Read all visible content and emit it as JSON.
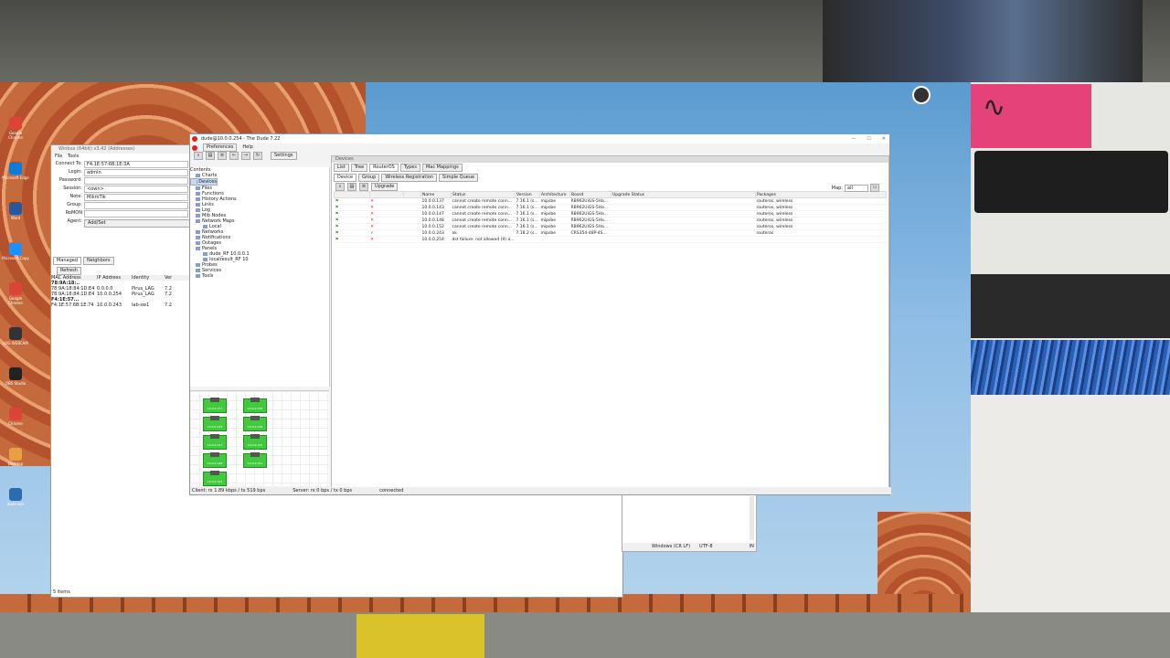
{
  "desktop": {
    "icons": [
      {
        "label": "Google Chrome",
        "color": "#db4437"
      },
      {
        "label": "Microsoft Edge",
        "color": "#0f7bd8"
      },
      {
        "label": "Word",
        "color": "#2b579a"
      },
      {
        "label": "Microsoft Copy",
        "color": "#1e90ff"
      },
      {
        "label": "Google Chrome",
        "color": "#db4437"
      },
      {
        "label": "LOG WEBCAM",
        "color": "#333333"
      },
      {
        "label": "OBS Studio",
        "color": "#222222"
      },
      {
        "label": "Chrome",
        "color": "#db4437"
      },
      {
        "label": "Desktop",
        "color": "#e8a040"
      },
      {
        "label": "dude-win",
        "color": "#2b6cb0"
      }
    ]
  },
  "winbox": {
    "title": "Winbox (64bit) v3.42 (Addresses)",
    "menu": [
      "File",
      "Tools"
    ],
    "fields": [
      {
        "label": "Connect To:",
        "value": "F4:1E:57:6B:1E:3A"
      },
      {
        "label": "Login:",
        "value": "admin"
      },
      {
        "label": "Password:",
        "value": ""
      },
      {
        "label": "Session:",
        "value": "<own>"
      },
      {
        "label": "Note:",
        "value": "MikroTik"
      },
      {
        "label": "Group:",
        "value": ""
      },
      {
        "label": "RoMON Agent:",
        "value": ""
      }
    ],
    "add_button": "Add/Set",
    "tabs": [
      "Managed",
      "Neighbors"
    ],
    "refresh": "Refresh",
    "columns": [
      "MAC Address",
      "IP Address",
      "Identity",
      "Vers"
    ],
    "rows": [
      [
        "78:9A:18:..",
        "",
        "",
        ""
      ],
      [
        "78:9A:18:84:1D:E4",
        "0.0.0.0",
        "Pirus_LAG",
        "7.22"
      ],
      [
        "78:9A:18:84:1D:E4",
        "10.0.0.254",
        "Pirus_LAG",
        "7.22"
      ],
      [
        "F4:1E:57...",
        "",
        "",
        ""
      ],
      [
        "F4:1E:57:6B:1E:74",
        "10.0.0.243",
        "lab-sw1",
        "7.22"
      ]
    ],
    "status": "5 items"
  },
  "bgwin": {
    "status": [
      "Windows (CR LF)",
      "UTF-8",
      "IN"
    ]
  },
  "dude": {
    "title": "dude@10.0.0.254 - The Dude 7.22",
    "menu": [
      "Preferences",
      "Help"
    ],
    "settings": "Settings",
    "tree_header": "Contents",
    "tree": [
      "Charts",
      "Devices",
      "Files",
      "Functions",
      "History Actions",
      "Links",
      "Log",
      "Mib Nodes",
      "Network Maps",
      "Local",
      "Networks",
      "Notifications",
      "Outages",
      "Panels",
      "dude_RF 10.0.0.1",
      "localresult_RF 10",
      "Probes",
      "Services",
      "Tools"
    ],
    "selected": "Devices",
    "panel_head": "Devices",
    "tabs": [
      "List",
      "Tree",
      "RouterOS",
      "Types",
      "Mac Mappings"
    ],
    "active_tab": "RouterOS",
    "subtabs": [
      "Device",
      "Group",
      "Wireless Registration",
      "Simple Queue"
    ],
    "upgrade": "Upgrade",
    "map_label": "Map:",
    "map_value": "all",
    "columns": [
      "Name",
      "Status",
      "Version",
      "Architecture",
      "Board",
      "Upgrade Status",
      "Packages"
    ],
    "rows": [
      {
        "name": "10.0.0.137",
        "status": "cannot create remote conn...",
        "version": "7.16.1 (s...",
        "arch": "mipsbe",
        "board": "RB962UiGS-5Ha...",
        "upgrade": "",
        "packages": "routeros, wireless"
      },
      {
        "name": "10.0.0.143",
        "status": "cannot create remote conn...",
        "version": "7.16.1 (s...",
        "arch": "mipsbe",
        "board": "RB962UiGS-5Ha...",
        "upgrade": "",
        "packages": "routeros, wireless"
      },
      {
        "name": "10.0.0.147",
        "status": "cannot create remote conn...",
        "version": "7.16.1 (s...",
        "arch": "mipsbe",
        "board": "RB962UiGS-5Ha...",
        "upgrade": "",
        "packages": "routeros, wireless"
      },
      {
        "name": "10.0.0.148",
        "status": "cannot create remote conn...",
        "version": "7.16.1 (s...",
        "arch": "mipsbe",
        "board": "RB962UiGS-5Ha...",
        "upgrade": "",
        "packages": "routeros, wireless"
      },
      {
        "name": "10.0.0.152",
        "status": "cannot create remote conn...",
        "version": "7.16.1 (s...",
        "arch": "mipsbe",
        "board": "RB962UiGS-5Ha...",
        "upgrade": "",
        "packages": "routeros, wireless"
      },
      {
        "name": "10.0.0.243",
        "status": "ok",
        "version": "7.18.2 (s...",
        "arch": "mipsbe",
        "board": "CRS354-48P-4S...",
        "upgrade": "",
        "packages": "routeros"
      },
      {
        "name": "10.0.0.254",
        "status": "dst failure: not allowed (9) a...",
        "version": "",
        "arch": "",
        "board": "",
        "upgrade": "",
        "packages": ""
      }
    ],
    "map_nodes": [
      "10.0.0.137",
      "10.0.0.138",
      "10.0.0.143",
      "10.0.0.146",
      "10.0.0.147",
      "10.0.0.150",
      "10.0.0.148",
      "10.0.0.151",
      "10.0.0.152"
    ],
    "status": {
      "client": "Client: rx 1.89 kbps / tx 519 bps",
      "server": "Server: rx 0 bps / tx 0 bps",
      "conn": "connected"
    }
  }
}
